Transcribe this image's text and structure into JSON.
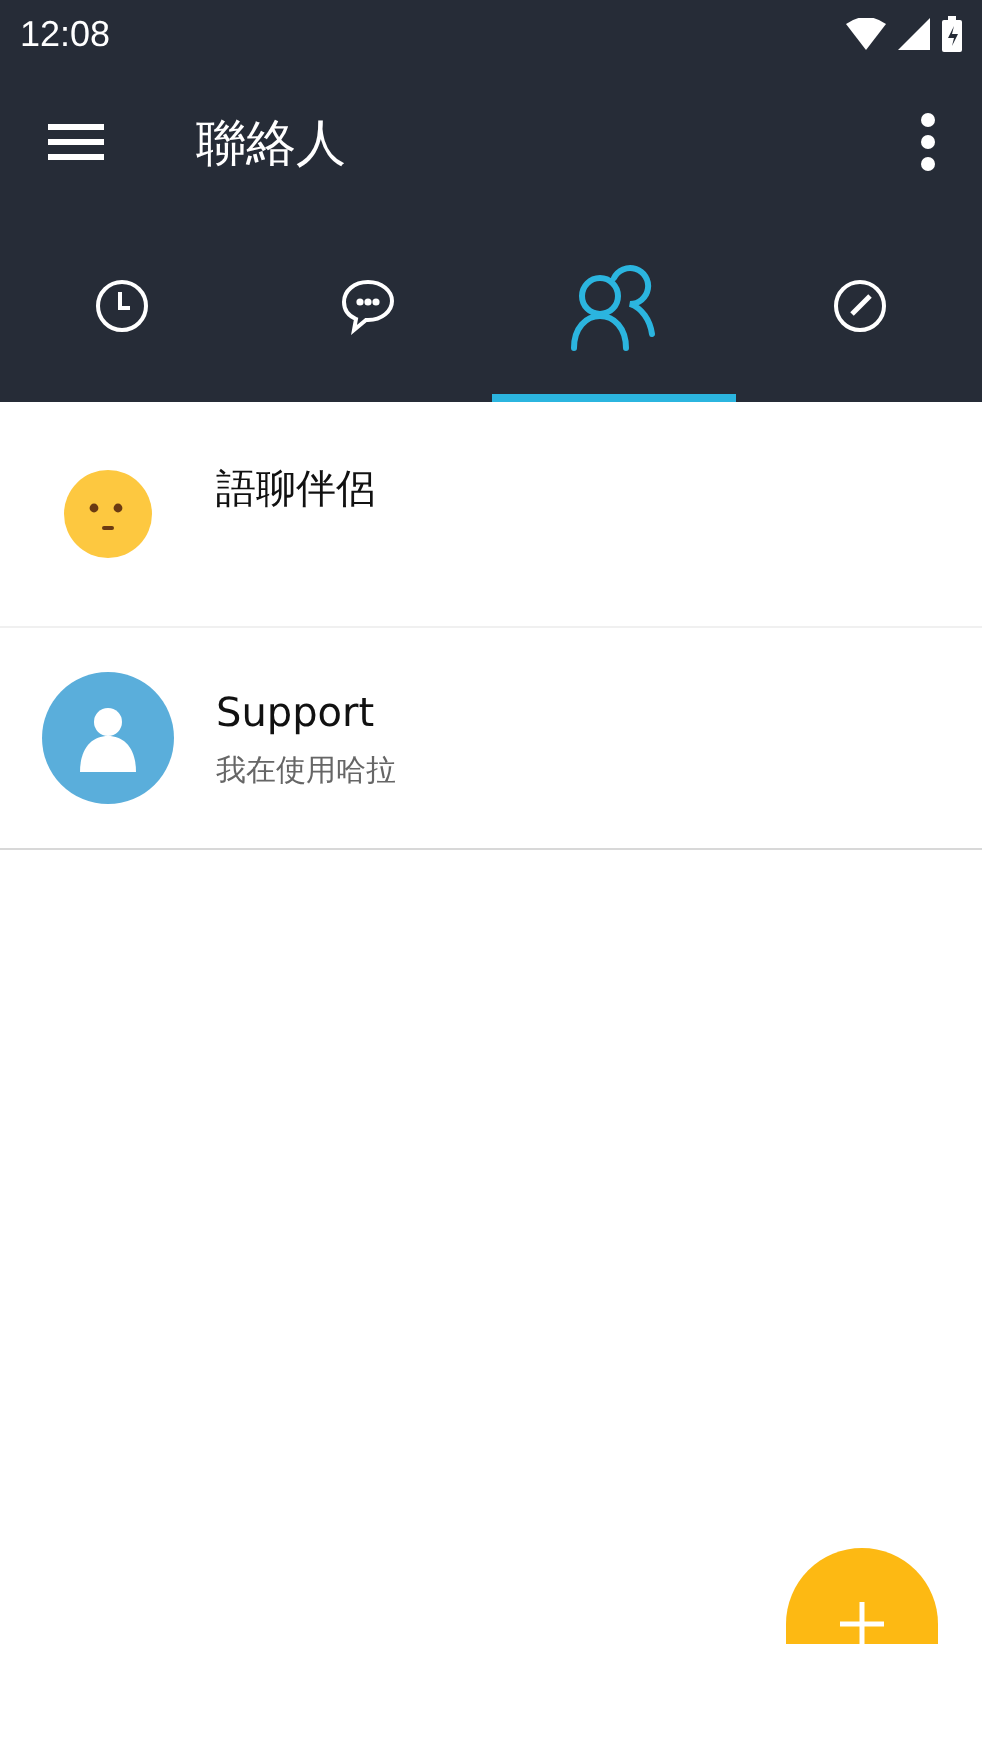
{
  "status_bar": {
    "time": "12:08"
  },
  "toolbar": {
    "title": "聯絡人"
  },
  "tabs": [
    {
      "kind": "clock",
      "selected": false
    },
    {
      "kind": "chat",
      "selected": false
    },
    {
      "kind": "people",
      "selected": true
    },
    {
      "kind": "compass",
      "selected": false
    }
  ],
  "contacts": [
    {
      "name": "語聊伴侶",
      "kind": "smiley"
    },
    {
      "name": "Support",
      "status": "我在使用哈拉",
      "kind": "person"
    }
  ]
}
